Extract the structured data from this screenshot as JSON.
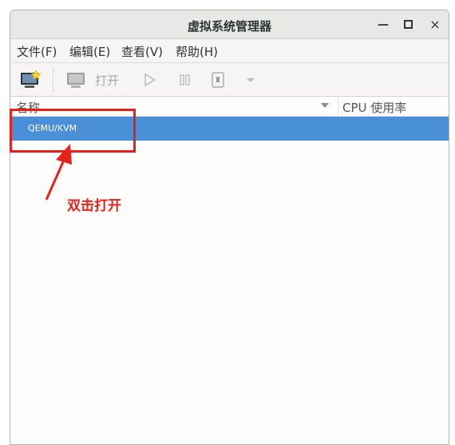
{
  "window": {
    "title": "虚拟系统管理器",
    "minimize_glyph": "—",
    "close_glyph": "×"
  },
  "menubar": {
    "items": [
      {
        "label": "文件(F)"
      },
      {
        "label": "编辑(E)"
      },
      {
        "label": "查看(V)"
      },
      {
        "label": "帮助(H)"
      }
    ]
  },
  "toolbar": {
    "new_vm_icon": "monitor-new-icon",
    "open_icon": "monitor-icon",
    "open_label": "打开",
    "run_icon": "play-icon",
    "pause_icon": "pause-icon",
    "shutdown_icon": "power-icon",
    "dropdown_icon": "chevron-down-icon"
  },
  "list": {
    "columns": [
      {
        "label": "名称"
      },
      {
        "label": "CPU 使用率"
      }
    ],
    "rows": [
      {
        "name": "QEMU/KVM",
        "selected": true
      }
    ]
  },
  "annotation": {
    "text": "双击打开",
    "color": "#e8201a"
  },
  "colors": {
    "selection": "#4a90d9",
    "titlebar": "#e8e8e7",
    "annotation": "#e8201a"
  }
}
